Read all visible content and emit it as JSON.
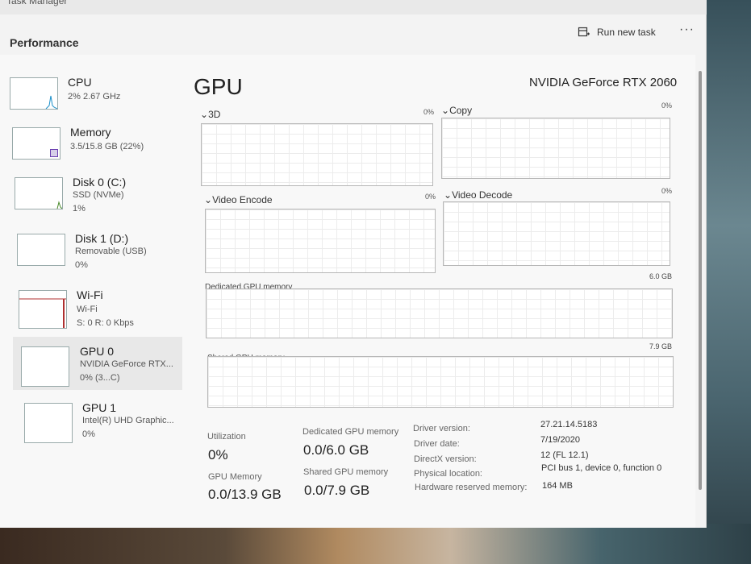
{
  "window": {
    "title": "Task Manager"
  },
  "header": {
    "title": "Performance",
    "run_new_task": "Run new task",
    "more": "···"
  },
  "sidebar": {
    "items": [
      {
        "name": "CPU",
        "line1": "2% 2.67 GHz",
        "line2": ""
      },
      {
        "name": "Memory",
        "line1": "3.5/15.8 GB (22%)",
        "line2": ""
      },
      {
        "name": "Disk 0 (C:)",
        "line1": "SSD (NVMe)",
        "line2": "1%"
      },
      {
        "name": "Disk 1 (D:)",
        "line1": "Removable (USB)",
        "line2": "0%"
      },
      {
        "name": "Wi-Fi",
        "line1": "Wi-Fi",
        "line2": "S: 0 R: 0 Kbps"
      },
      {
        "name": "GPU 0",
        "line1": "NVIDIA GeForce RTX...",
        "line2": "0% (3...C)"
      },
      {
        "name": "GPU 1",
        "line1": "Intel(R) UHD Graphic...",
        "line2": "0%"
      }
    ]
  },
  "main": {
    "title": "GPU",
    "gpu_name": "NVIDIA GeForce RTX 2060",
    "engines": [
      {
        "label": "3D",
        "percent": "0%"
      },
      {
        "label": "Copy",
        "percent": "0%"
      },
      {
        "label": "Video Encode",
        "percent": "0%"
      },
      {
        "label": "Video Decode",
        "percent": "0%"
      }
    ],
    "dedicated_graph": {
      "label": "Dedicated GPU memory",
      "max": "6.0 GB"
    },
    "shared_graph": {
      "label": "Shared GPU memory",
      "max": "7.9 GB"
    },
    "stats": {
      "utilization_label": "Utilization",
      "utilization_value": "0%",
      "dedicated_label": "Dedicated GPU memory",
      "dedicated_value": "0.0/6.0 GB",
      "gpu_memory_label": "GPU Memory",
      "gpu_memory_value": "0.0/13.9 GB",
      "shared_label": "Shared GPU memory",
      "shared_value": "0.0/7.9 GB"
    },
    "properties": [
      {
        "label": "Driver version:",
        "value": "27.21.14.5183"
      },
      {
        "label": "Driver date:",
        "value": "7/19/2020"
      },
      {
        "label": "DirectX version:",
        "value": "12 (FL 12.1)"
      },
      {
        "label": "Physical location:",
        "value": "PCI bus 1, device 0, function 0"
      },
      {
        "label": "Hardware reserved memory:",
        "value": "164 MB"
      }
    ]
  },
  "colors": {
    "cpu": "#1a8fc9",
    "memory": "#6a3fb0",
    "disk": "#4a8a2a",
    "wifi": "#b03030"
  }
}
